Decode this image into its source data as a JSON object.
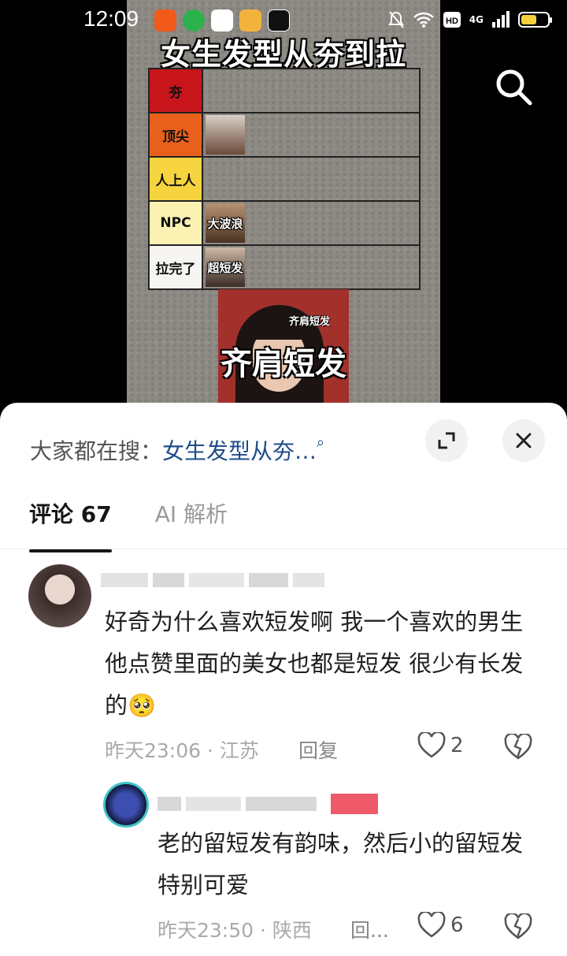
{
  "status_bar": {
    "time": "12:09",
    "network": "4G",
    "battery_level": 0.6
  },
  "video": {
    "title": "女生发型从夯到拉",
    "tiers": [
      {
        "label": "夯",
        "color": "#c8151b",
        "thumb_caption": ""
      },
      {
        "label": "顶尖",
        "color": "#e8601c",
        "thumb_caption": ""
      },
      {
        "label": "人上人",
        "color": "#f5d43f",
        "thumb_caption": ""
      },
      {
        "label": "NPC",
        "color": "#fbf1b3",
        "thumb_caption": "大波浪"
      },
      {
        "label": "拉完了",
        "color": "#f7f5f2",
        "thumb_caption": "超短发"
      }
    ],
    "card_title": "齐肩短发",
    "card_subtitle": "齐肩短发"
  },
  "sheet": {
    "search_prefix": "大家都在搜：",
    "search_query": "女生发型从夯…",
    "tabs": [
      {
        "label": "评论 67"
      },
      {
        "label": "AI 解析"
      }
    ]
  },
  "comments": [
    {
      "text": "好奇为什么喜欢短发啊 我一个喜欢的男生 他点赞里面的美女也都是短发 很少有长发的🥺",
      "meta": "昨天23:06 · 江苏",
      "reply_label": "回复",
      "likes": "2"
    },
    {
      "text": "老的留短发有韵味，然后小的留短发特别可爱",
      "meta": "昨天23:50 · 陕西",
      "reply_label": "回...",
      "likes": "6"
    }
  ]
}
